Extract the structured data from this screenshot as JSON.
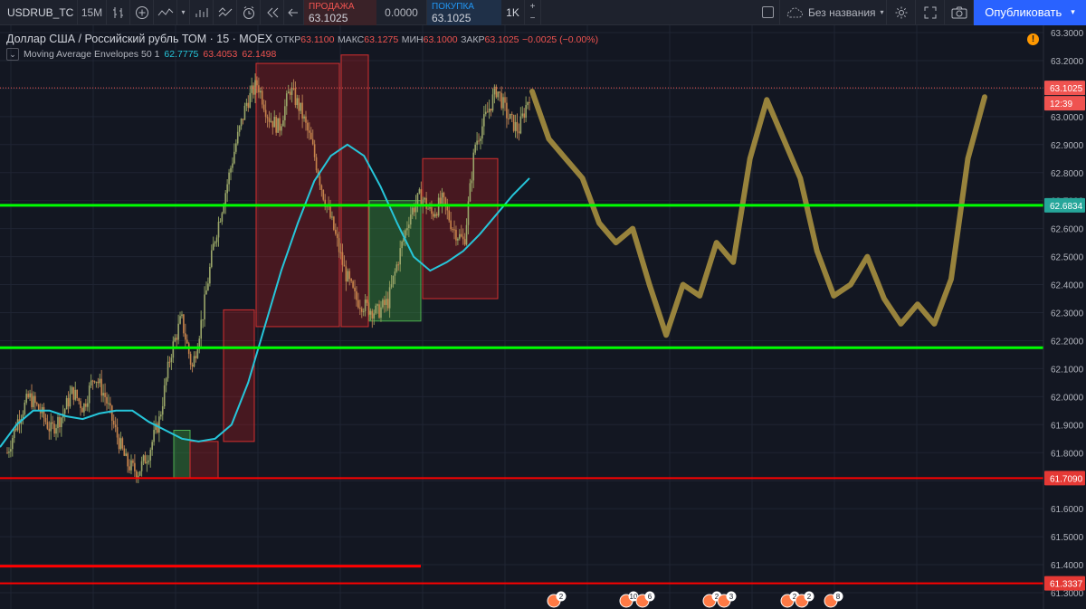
{
  "toolbar": {
    "symbol": "USDRUB_TC",
    "interval": "15M",
    "sell_label": "ПРОДАЖА",
    "sell_price": "63.1025",
    "spread": "0.0000",
    "buy_label": "ПОКУПКА",
    "buy_price": "63.1025",
    "quantity": "1K",
    "layout_name": "Без названия",
    "publish_label": "Опубликовать"
  },
  "legend": {
    "title": "Доллар США / Российский рубль ТОМ · 15 · MOEX",
    "open_label": "ОТКР",
    "open": "63.1100",
    "high_label": "МАКС",
    "high": "63.1275",
    "low_label": "МИН",
    "low": "63.1000",
    "close_label": "ЗАКР",
    "close": "63.1025",
    "change": "−0.0025 (−0.00%)",
    "indicator_name": "Moving Average Envelopes 50 1",
    "indicator_values": [
      "62.7775",
      "63.4053",
      "62.1498"
    ]
  },
  "price_axis": {
    "ticks": [
      "63.3000",
      "63.2000",
      "63.1000",
      "63.0000",
      "62.9000",
      "62.8000",
      "62.7000",
      "62.6000",
      "62.5000",
      "62.4000",
      "62.3000",
      "62.2000",
      "62.1000",
      "62.0000",
      "61.9000",
      "61.8000",
      "61.7000",
      "61.6000",
      "61.5000",
      "61.4000",
      "61.3000"
    ],
    "badges": [
      {
        "text": "63.1025",
        "color": "#ef5350"
      },
      {
        "text": "12:39",
        "color": "#ef5350"
      },
      {
        "text": "62.6834",
        "color": "#26a69a"
      },
      {
        "text": "61.7090",
        "color": "#e53935"
      },
      {
        "text": "61.3337",
        "color": "#e53935"
      }
    ]
  },
  "events": [
    {
      "label": "2"
    },
    {
      "label": "10"
    },
    {
      "label": "6"
    },
    {
      "label": "2"
    },
    {
      "label": "3"
    },
    {
      "label": "2"
    },
    {
      "label": "2"
    },
    {
      "label": "8"
    }
  ],
  "colors": {
    "background": "#131722",
    "up_candle": "#26a69a",
    "down_candle": "#ef5350",
    "moving_average": "#26c6da",
    "support_line": "#00ff00",
    "resistance_line": "#ff0000",
    "drawing": "#a78f3f"
  },
  "chart_data": {
    "type": "line",
    "y_unit": "RUB per USD",
    "ylim": [
      61.29,
      63.32
    ],
    "horizontal_levels": [
      {
        "value": 62.6834,
        "color": "#00ff00"
      },
      {
        "value": 62.175,
        "color": "#00ff00"
      },
      {
        "value": 61.709,
        "color": "#ff0000"
      },
      {
        "value": 61.3337,
        "color": "#ff0000"
      },
      {
        "value": 61.395,
        "color": "#ff0000",
        "partial": true
      }
    ],
    "rectangles": [
      {
        "y1": 61.71,
        "y2": 61.88,
        "color": "green"
      },
      {
        "y1": 61.71,
        "y2": 61.84,
        "color": "red"
      },
      {
        "y1": 61.84,
        "y2": 62.31,
        "color": "red"
      },
      {
        "y1": 62.25,
        "y2": 63.19,
        "color": "red"
      },
      {
        "y1": 62.25,
        "y2": 63.22,
        "color": "red"
      },
      {
        "y1": 62.27,
        "y2": 62.7,
        "color": "green"
      },
      {
        "y1": 62.35,
        "y2": 62.85,
        "color": "red"
      }
    ],
    "price_path": [
      61.8,
      61.92,
      62.0,
      61.95,
      61.88,
      61.93,
      62.02,
      61.96,
      62.08,
      62.0,
      61.87,
      61.76,
      61.73,
      61.8,
      61.92,
      62.15,
      62.28,
      62.1,
      62.3,
      62.55,
      62.72,
      62.9,
      63.05,
      63.12,
      63.0,
      62.96,
      63.1,
      63.02,
      62.9,
      62.73,
      62.6,
      62.45,
      62.35,
      62.32,
      62.3,
      62.34,
      62.5,
      62.65,
      62.72,
      62.65,
      62.7,
      62.6,
      62.55,
      62.9,
      63.0,
      63.1,
      63.0,
      62.95,
      63.08
    ],
    "moving_average_path": [
      61.82,
      61.9,
      61.95,
      61.95,
      61.93,
      61.92,
      61.94,
      61.95,
      61.95,
      61.91,
      61.88,
      61.85,
      61.84,
      61.85,
      61.9,
      62.05,
      62.25,
      62.45,
      62.62,
      62.77,
      62.86,
      62.9,
      62.86,
      62.75,
      62.62,
      62.5,
      62.45,
      62.48,
      62.52,
      62.58,
      62.65,
      62.72,
      62.78
    ],
    "forecast_path": [
      63.09,
      62.92,
      62.85,
      62.78,
      62.62,
      62.55,
      62.6,
      62.4,
      62.22,
      62.4,
      62.36,
      62.55,
      62.48,
      62.85,
      63.06,
      62.92,
      62.78,
      62.52,
      62.36,
      62.4,
      62.5,
      62.35,
      62.26,
      62.33,
      62.26,
      62.42,
      62.85,
      63.07
    ]
  }
}
